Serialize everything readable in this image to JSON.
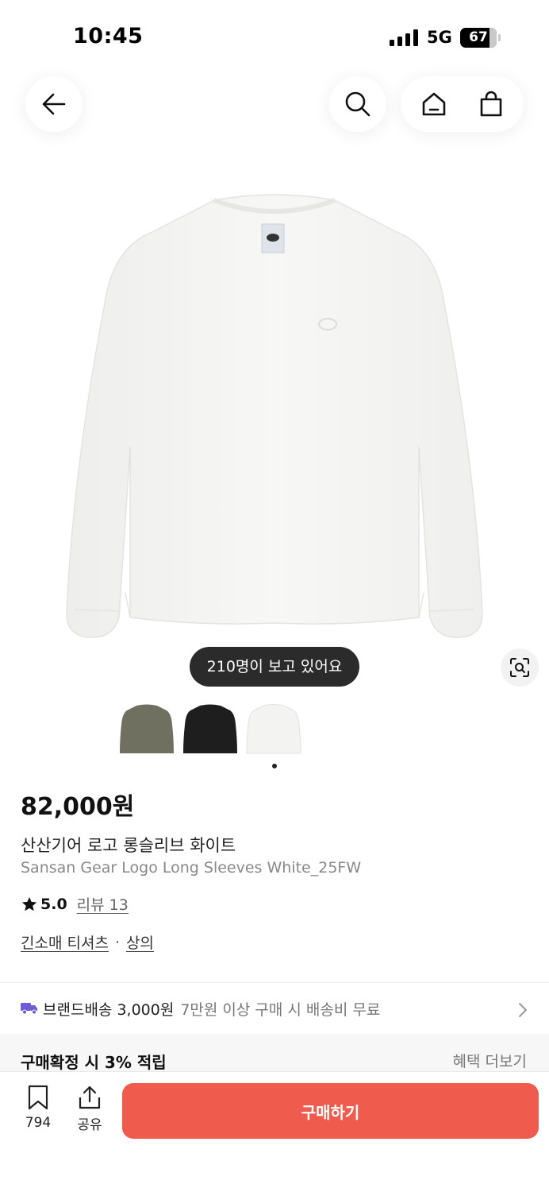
{
  "status_bar": {
    "time": "10:45",
    "network": "5G",
    "battery": "67"
  },
  "product": {
    "viewers_text": "210명이 보고 있어요",
    "price": "82,000원",
    "name_ko": "산산기어 로고 롱슬리브 화이트",
    "name_en": "Sansan Gear Logo Long Sleeves White_25FW",
    "rating": "5.0",
    "reviews_label": "리뷰 13",
    "category_primary": "긴소매 티셔츠",
    "category_separator": "·",
    "category_secondary": "상의",
    "color_variants": [
      {
        "name": "olive",
        "color": "#6f705f"
      },
      {
        "name": "black",
        "color": "#1e1e1e"
      },
      {
        "name": "white",
        "color": "#f3f3f1"
      }
    ]
  },
  "shipping": {
    "label": "브랜드배송 3,000원",
    "note": "7만원 이상 구매 시 배송비 무료"
  },
  "benefit": {
    "label": "구매확정 시 3% 적립",
    "more": "혜택 더보기"
  },
  "bottom_bar": {
    "bookmark_count": "794",
    "share_label": "공유",
    "buy_label": "구매하기"
  },
  "colors": {
    "accent": "#ef5b4c",
    "truck_icon": "#6e5bd6"
  }
}
